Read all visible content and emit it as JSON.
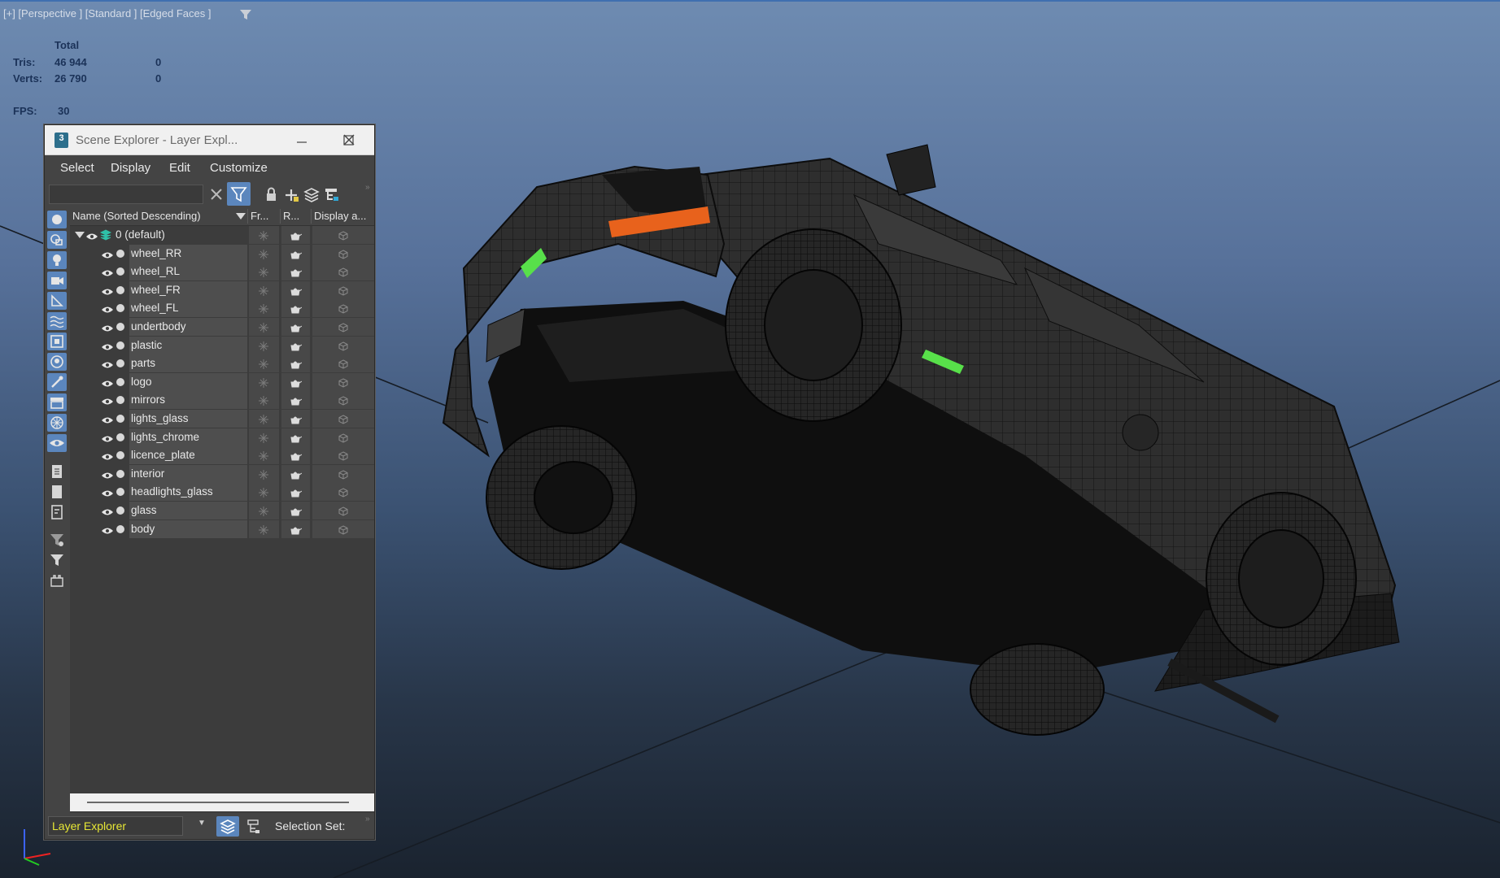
{
  "viewport": {
    "label": "[+] [Perspective ] [Standard ] [Edged Faces ]",
    "stats": {
      "total_label": "Total",
      "tris_label": "Tris:",
      "tris_total": "46 944",
      "tris_sel": "0",
      "verts_label": "Verts:",
      "verts_total": "26 790",
      "verts_sel": "0",
      "fps_label": "FPS:",
      "fps_value": "30"
    }
  },
  "explorer": {
    "title": "Scene Explorer - Layer Expl...",
    "app_icon": "3",
    "menu": [
      "Select",
      "Display",
      "Edit",
      "Customize"
    ],
    "search": {
      "value": "",
      "placeholder": ""
    },
    "columns": {
      "name": "Name (Sorted Descending)",
      "freeze": "Fr...",
      "render": "R...",
      "display": "Display a..."
    },
    "root_layer": "0 (default)",
    "layers": [
      "wheel_RR",
      "wheel_RL",
      "wheel_FR",
      "wheel_FL",
      "undertbody",
      "plastic",
      "parts",
      "logo",
      "mirrors",
      "lights_glass",
      "lights_chrome",
      "licence_plate",
      "interior",
      "headlights_glass",
      "glass",
      "body"
    ],
    "bottom": {
      "mode": "Layer Explorer",
      "selection_set_label": "Selection Set:"
    }
  },
  "colors": {
    "accent": "#5b86bd",
    "panel": "#444444",
    "mode_text": "#e7e735",
    "highlight_orange": "#e8621c",
    "highlight_green": "#58e04a"
  },
  "icons": {
    "viewport_filter": "filter-icon",
    "toolbar": [
      "clear-x-icon",
      "filter-icon",
      "lock-icon",
      "add-layer-icon",
      "layers-stack-icon",
      "hierarchy-icon"
    ],
    "sidebar": [
      "geometry-icon",
      "shapes-icon",
      "light-icon",
      "camera-icon",
      "helper-icon",
      "spacewarp-icon",
      "group-icon",
      "xref-icon",
      "bone-icon",
      "container-icon",
      "frozen-icon",
      "visible-icon",
      "select-all-icon",
      "select-none-icon",
      "invert-icon",
      "filter-off-icon",
      "filter-icon",
      "selection-icon"
    ]
  }
}
